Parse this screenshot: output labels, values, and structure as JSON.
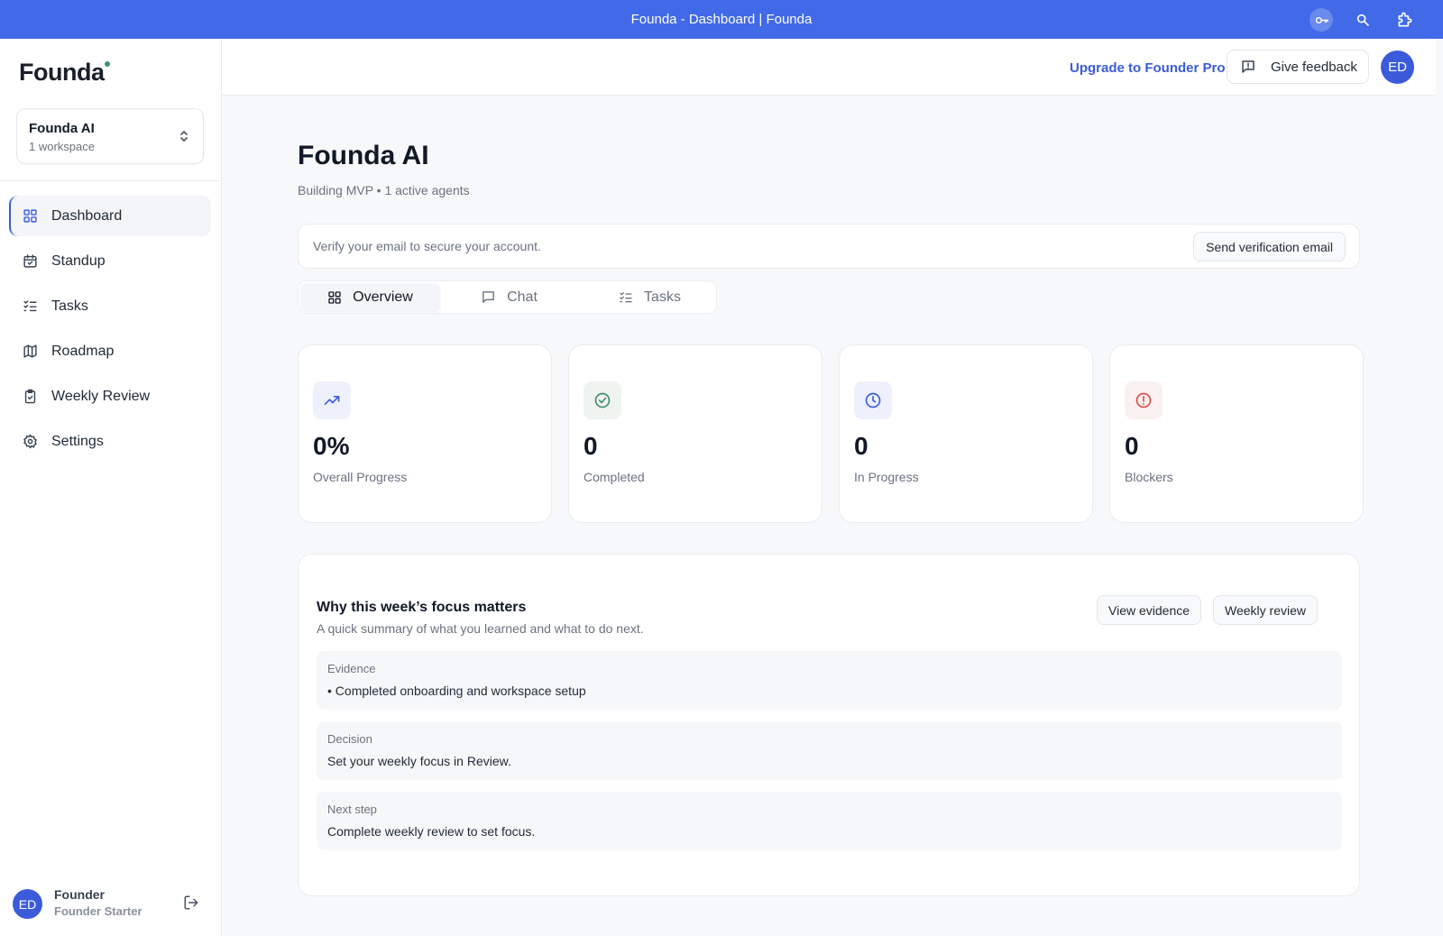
{
  "window": {
    "title": "Founda - Dashboard | Founda"
  },
  "sidebar": {
    "logo": "Founda",
    "workspace": {
      "name": "Founda AI",
      "sub": "1 workspace"
    },
    "items": [
      {
        "label": "Dashboard",
        "icon": "grid-icon",
        "active": true
      },
      {
        "label": "Standup",
        "icon": "calendar-check-icon"
      },
      {
        "label": "Tasks",
        "icon": "list-checks-icon"
      },
      {
        "label": "Roadmap",
        "icon": "map-icon"
      },
      {
        "label": "Weekly Review",
        "icon": "clipboard-check-icon"
      },
      {
        "label": "Settings",
        "icon": "gear-icon"
      }
    ],
    "user": {
      "initials": "ED",
      "name": "Founder",
      "plan": "Founder Starter"
    }
  },
  "header": {
    "upgrade": "Upgrade to Founder Pro",
    "feedback": "Give feedback",
    "avatar": "ED"
  },
  "main": {
    "title": "Founda AI",
    "subtitle": "Building MVP • 1 active agents",
    "verify": {
      "text": "Verify your email to secure your account.",
      "button": "Send verification email"
    },
    "tabs": [
      {
        "label": "Overview",
        "active": true
      },
      {
        "label": "Chat"
      },
      {
        "label": "Tasks"
      }
    ],
    "stats": [
      {
        "value": "0%",
        "label": "Overall Progress",
        "icon": "trending-up-icon",
        "color": "#3b5bdb"
      },
      {
        "value": "0",
        "label": "Completed",
        "icon": "check-circle-icon",
        "color": "#3f8f6b"
      },
      {
        "value": "0",
        "label": "In Progress",
        "icon": "clock-icon",
        "color": "#3b5bdb"
      },
      {
        "value": "0",
        "label": "Blockers",
        "icon": "alert-circle-icon",
        "color": "#dc4b4b"
      }
    ],
    "focus": {
      "title": "Why this week’s focus matters",
      "subtitle": "A quick summary of what you learned and what to do next.",
      "buttons": [
        "View evidence",
        "Weekly review"
      ],
      "sections": [
        {
          "label": "Evidence",
          "text": "• Completed onboarding and workspace setup"
        },
        {
          "label": "Decision",
          "text": "Set your weekly focus in Review."
        },
        {
          "label": "Next step",
          "text": "Complete weekly review to set focus."
        }
      ]
    }
  }
}
